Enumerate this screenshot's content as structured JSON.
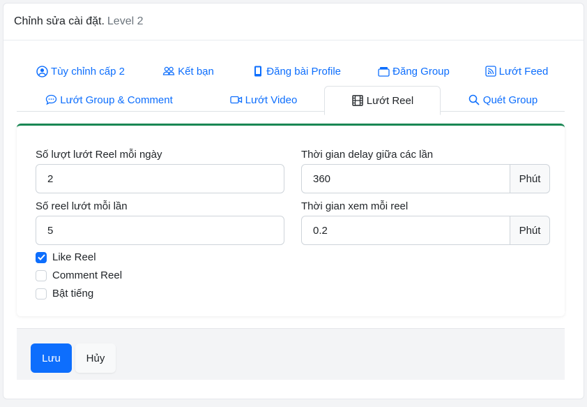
{
  "header": {
    "title": "Chỉnh sửa cài đặt.",
    "subtitle": "Level 2"
  },
  "tabs": [
    {
      "label": "Tùy chỉnh cấp 2",
      "icon": "user-circle-icon"
    },
    {
      "label": "Kết bạn",
      "icon": "users-icon"
    },
    {
      "label": "Đăng bài Profile",
      "icon": "phone-icon"
    },
    {
      "label": "Đăng Group",
      "icon": "group-window-icon"
    },
    {
      "label": "Lướt Feed",
      "icon": "rss-icon"
    },
    {
      "label": "Lướt Group & Comment",
      "icon": "chat-icon"
    },
    {
      "label": "Lướt Video",
      "icon": "video-icon"
    },
    {
      "label": "Lướt Reel",
      "icon": "film-icon",
      "active": true
    },
    {
      "label": "Quét Group",
      "icon": "search-icon"
    }
  ],
  "form": {
    "reels_per_day_label": "Số lượt lướt Reel mỗi ngày",
    "reels_per_day_value": "2",
    "delay_label": "Thời gian delay giữa các lần",
    "delay_value": "360",
    "delay_unit": "Phút",
    "reels_per_time_label": "Số reel lướt mỗi lần",
    "reels_per_time_value": "5",
    "watch_time_label": "Thời gian xem mỗi reel",
    "watch_time_value": "0.2",
    "watch_time_unit": "Phút",
    "checkboxes": [
      {
        "label": "Like Reel",
        "checked": true
      },
      {
        "label": "Comment Reel",
        "checked": false
      },
      {
        "label": "Bật tiếng",
        "checked": false
      }
    ]
  },
  "footer": {
    "save_label": "Lưu",
    "cancel_label": "Hủy"
  },
  "colors": {
    "primary": "#0d6efd",
    "panel_accent": "#198754"
  }
}
